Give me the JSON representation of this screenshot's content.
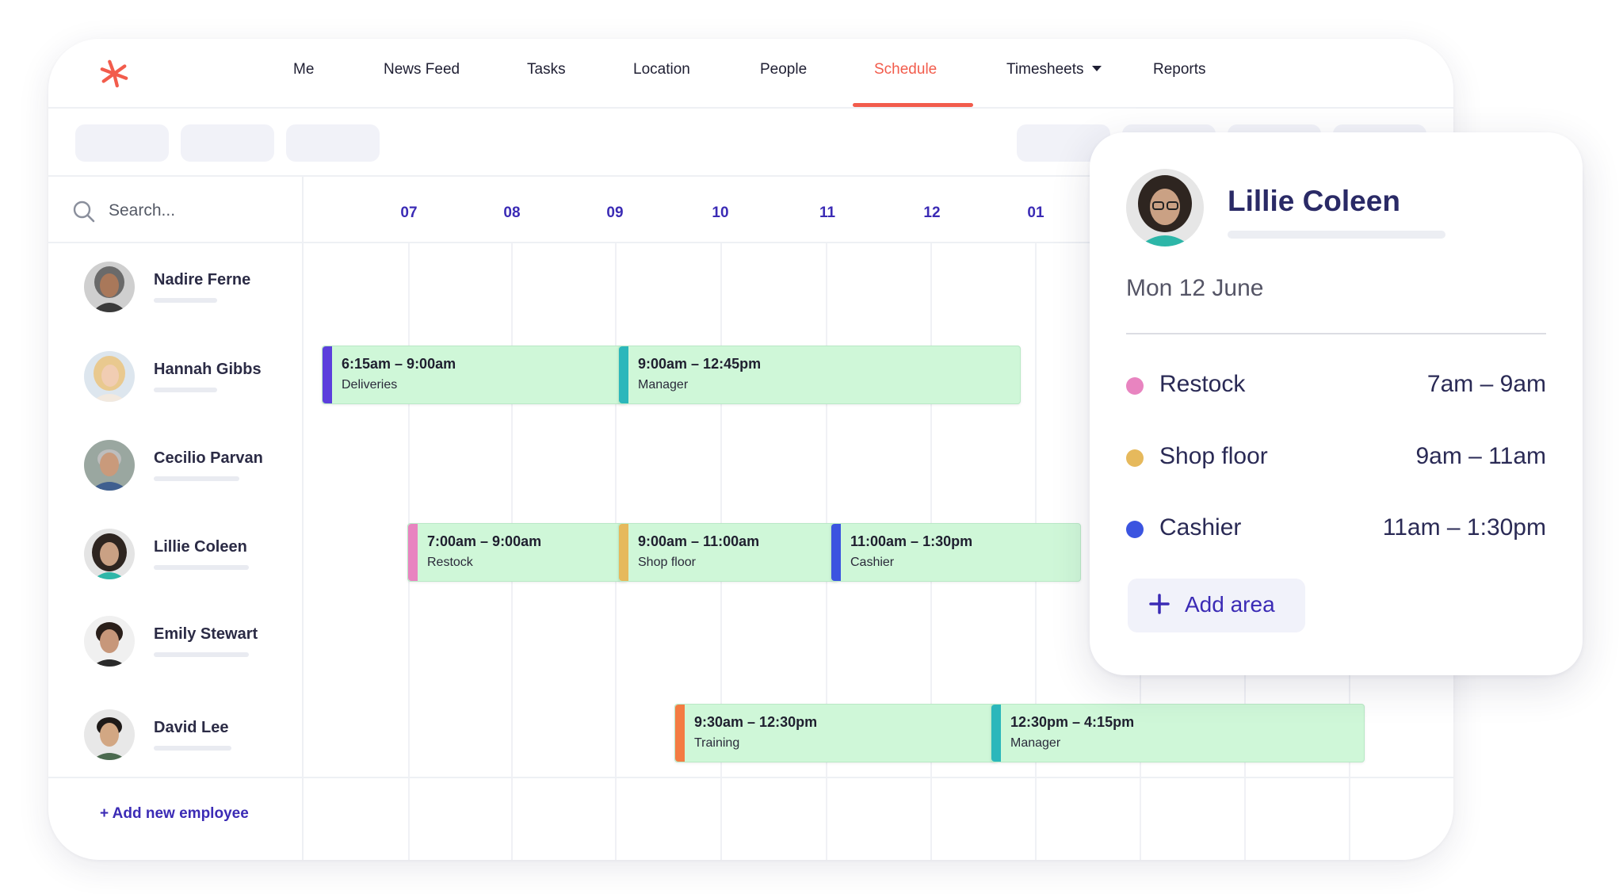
{
  "nav": {
    "items": [
      {
        "label": "Me"
      },
      {
        "label": "News Feed"
      },
      {
        "label": "Tasks"
      },
      {
        "label": "Location"
      },
      {
        "label": "People"
      },
      {
        "label": "Schedule",
        "active": true
      },
      {
        "label": "Timesheets",
        "has_dropdown": true
      },
      {
        "label": "Reports"
      }
    ]
  },
  "search": {
    "placeholder": "Search..."
  },
  "timeline": {
    "hours": [
      "07",
      "08",
      "09",
      "10",
      "11",
      "12",
      "01"
    ]
  },
  "employees": [
    {
      "name": "Nadire Ferne"
    },
    {
      "name": "Hannah Gibbs"
    },
    {
      "name": "Cecilio Parvan"
    },
    {
      "name": "Lillie Coleen"
    },
    {
      "name": "Emily Stewart"
    },
    {
      "name": "David Lee"
    }
  ],
  "add_employee_label": "+ Add new employee",
  "shifts": [
    {
      "employee": "Hannah Gibbs",
      "time": "6:15am – 9:00am",
      "role": "Deliveries",
      "color": "#5b3fdc"
    },
    {
      "employee": "Hannah Gibbs",
      "time": "9:00am – 12:45pm",
      "role": "Manager",
      "color": "#2bb7bb"
    },
    {
      "employee": "Lillie Coleen",
      "time": "7:00am – 9:00am",
      "role": "Restock",
      "color": "#e884c0"
    },
    {
      "employee": "Lillie Coleen",
      "time": "9:00am – 11:00am",
      "role": "Shop floor",
      "color": "#e6b95c"
    },
    {
      "employee": "Lillie Coleen",
      "time": "11:00am – 1:30pm",
      "role": "Cashier",
      "color": "#3b54e0"
    },
    {
      "employee": "David Lee",
      "time": "9:30am – 12:30pm",
      "role": "Training",
      "color": "#f47b42"
    },
    {
      "employee": "David Lee",
      "time": "12:30pm – 4:15pm",
      "role": "Manager",
      "color": "#2bb7bb"
    }
  ],
  "popup": {
    "name": "Lillie Coleen",
    "date": "Mon 12 June",
    "areas": [
      {
        "name": "Restock",
        "time": "7am – 9am",
        "color": "#e884c0"
      },
      {
        "name": "Shop floor",
        "time": "9am – 11am",
        "color": "#e6b95c"
      },
      {
        "name": "Cashier",
        "time": "11am – 1:30pm",
        "color": "#3b54e0"
      }
    ],
    "add_area_label": "Add area"
  },
  "colors": {
    "accent": "#f25c4c",
    "primary": "#3b2bb5",
    "shift_bg": "#cff7d8"
  }
}
